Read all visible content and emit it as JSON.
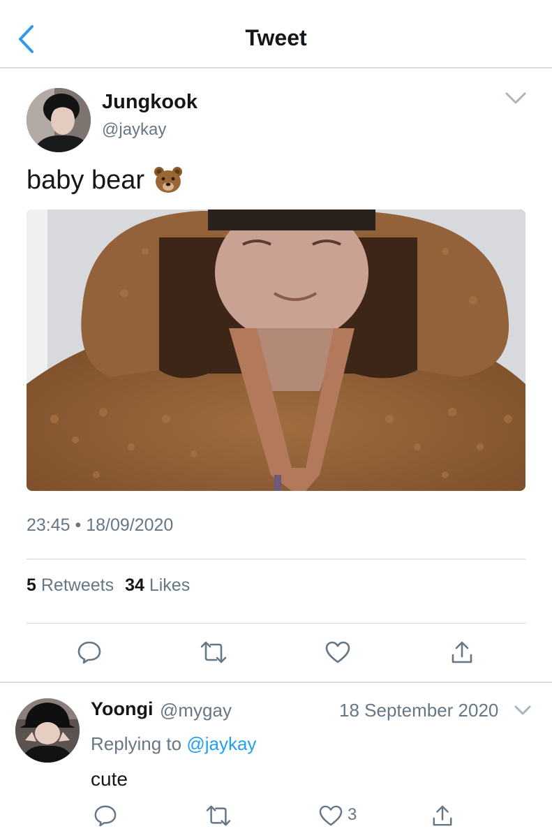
{
  "header": {
    "title": "Tweet"
  },
  "tweet": {
    "author_name": "Jungkook",
    "author_handle": "@jaykay",
    "text": "baby bear",
    "emoji": "bear-face",
    "timestamp": "23:45 • 18/09/2020",
    "stats": {
      "retweets_count": "5",
      "retweets_label": "Retweets",
      "likes_count": "34",
      "likes_label": "Likes"
    }
  },
  "reply": {
    "author_name": "Yoongi",
    "author_handle": "@mygay",
    "date": "18 September 2020",
    "replying_prefix": "Replying to",
    "replying_handle": "@jaykay",
    "text": "cute",
    "like_count": "3"
  },
  "colors": {
    "accent": "#1da1f2",
    "secondary_text": "#657786",
    "primary_text": "#14171a",
    "icon_gray": "#657786",
    "back_arrow": "#1da1f2"
  }
}
